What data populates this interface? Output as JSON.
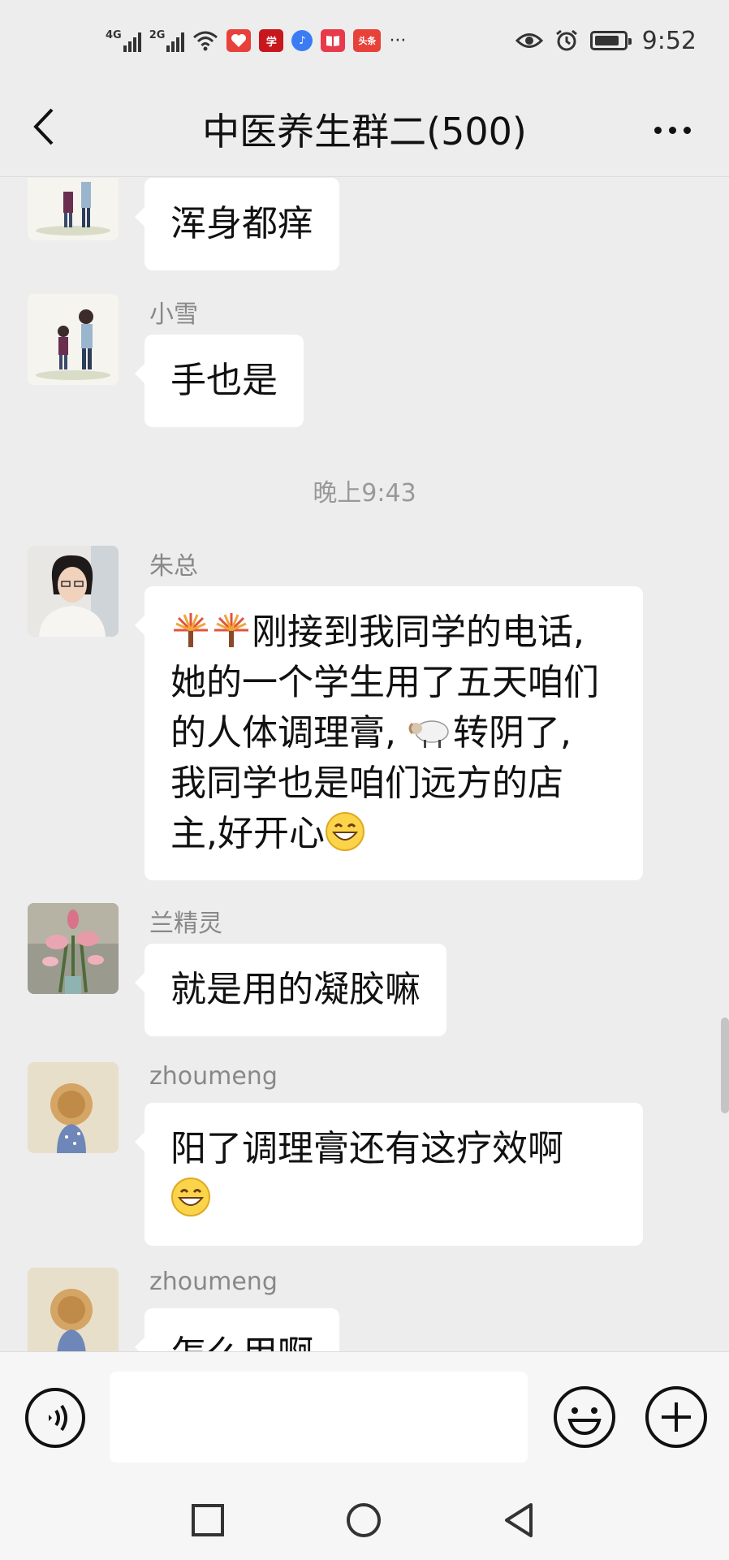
{
  "status_bar": {
    "net1": "4G",
    "net2": "2G",
    "app_icons": [
      {
        "label": "",
        "color": "#e8413a",
        "name": "heart-app-icon"
      },
      {
        "label": "学",
        "color": "#c8161d",
        "name": "study-app-icon"
      },
      {
        "label": "♪",
        "color": "#3b7cf5",
        "name": "music-app-icon"
      },
      {
        "label": "",
        "color": "#e83a4a",
        "name": "book-app-icon"
      },
      {
        "label": "头条",
        "color": "#e8413a",
        "name": "toutiao-app-icon"
      }
    ],
    "more": "···",
    "time": "9:52",
    "battery_level": 0.85
  },
  "header": {
    "title": "中医养生群二(500)"
  },
  "messages": [
    {
      "sender": "",
      "text": "浑身都痒"
    },
    {
      "sender": "小雪",
      "text": "手也是"
    },
    {
      "time": "晚上9:43"
    },
    {
      "sender": "朱总",
      "lines": [
        "刚接到我同学的电话,",
        "她的一个学生用了五天咱们",
        "的人体调理膏,",
        "转阴了,",
        "我同学也是咱们远方的店",
        "主,好开心"
      ]
    },
    {
      "sender": "兰精灵",
      "text": "就是用的凝胶嘛"
    },
    {
      "sender": "zhoumeng",
      "text": "阳了调理膏还有这疗效啊"
    },
    {
      "sender": "zhoumeng",
      "text": "怎么用啊"
    }
  ],
  "input": {
    "value": "",
    "placeholder": ""
  },
  "colors": {
    "background": "#ededed",
    "bubble": "#ffffff",
    "meta_text": "#888888"
  }
}
